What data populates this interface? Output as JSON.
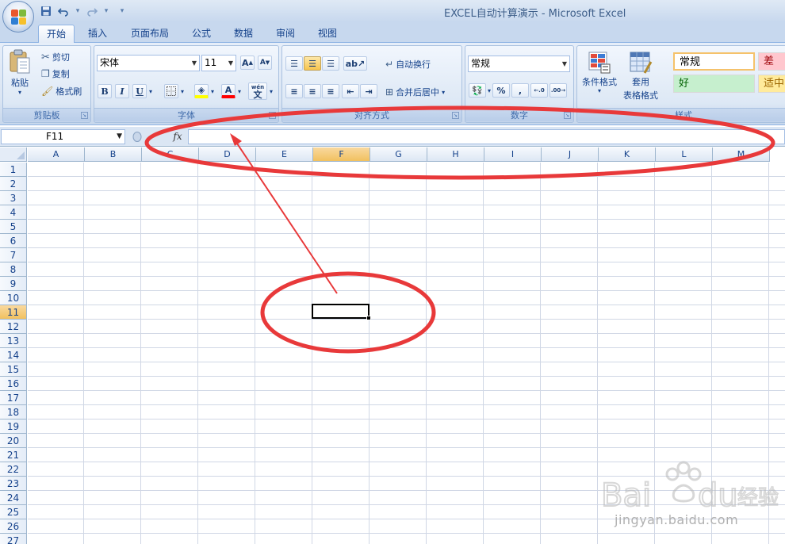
{
  "window": {
    "title": "EXCEL自动计算演示 - Microsoft Excel"
  },
  "qat": {
    "items": [
      "save-icon",
      "undo-icon",
      "redo-icon",
      "customize-icon"
    ]
  },
  "tabs": [
    {
      "label": "开始",
      "active": true
    },
    {
      "label": "插入"
    },
    {
      "label": "页面布局"
    },
    {
      "label": "公式"
    },
    {
      "label": "数据"
    },
    {
      "label": "审阅"
    },
    {
      "label": "视图"
    }
  ],
  "ribbon": {
    "clipboard": {
      "label": "剪贴板",
      "paste": "粘贴",
      "cut": "剪切",
      "copy": "复制",
      "format_painter": "格式刷"
    },
    "font": {
      "label": "字体",
      "font_name": "宋体",
      "font_size": "11",
      "grow": "A",
      "shrink": "A",
      "bold": "B",
      "italic": "I",
      "underline": "U",
      "font_color": "A",
      "phonetic": "wén"
    },
    "alignment": {
      "label": "对齐方式",
      "wrap_text": "自动换行",
      "merge_center": "合并后居中"
    },
    "number": {
      "label": "数字",
      "format": "常规",
      "percent": "%",
      "comma": ","
    },
    "styles": {
      "label": "样式",
      "conditional_format_1": "条件格式",
      "format_table_1": "套用",
      "format_table_2": "表格格式",
      "normal": "常规",
      "bad": "差",
      "good": "好",
      "neutral": "适中"
    }
  },
  "formula_bar": {
    "name_box": "F11",
    "fx": "fx",
    "value": ""
  },
  "sheet": {
    "columns": [
      "A",
      "B",
      "C",
      "D",
      "E",
      "F",
      "G",
      "H",
      "I",
      "J",
      "K",
      "L",
      "M"
    ],
    "rows": [
      "1",
      "2",
      "3",
      "4",
      "5",
      "6",
      "7",
      "8",
      "9",
      "10",
      "11",
      "12",
      "13",
      "14",
      "15",
      "16",
      "17",
      "18",
      "19",
      "20",
      "21",
      "22",
      "23",
      "24",
      "25",
      "26",
      "27"
    ],
    "active_column": "F",
    "active_row": "11"
  },
  "watermark": {
    "brand": "Bai du 经验",
    "url": "jingyan.baidu.com"
  },
  "colors": {
    "annotation_red": "#e8393a",
    "active_header": "#f1c15f",
    "ribbon_text": "#15428b"
  }
}
